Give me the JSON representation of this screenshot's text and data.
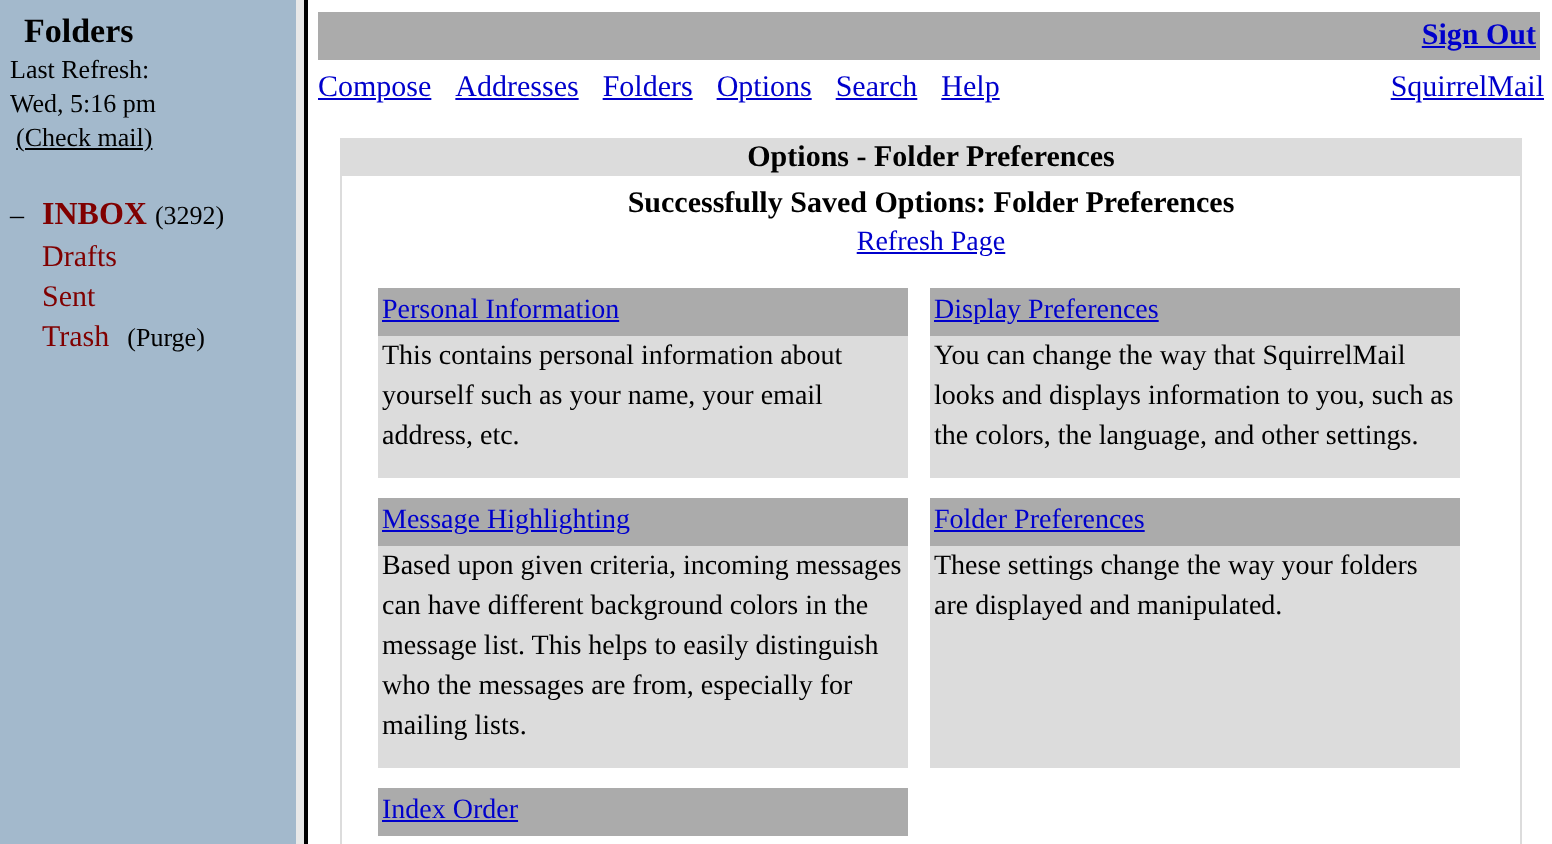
{
  "sidebar": {
    "title": "Folders",
    "refresh_label": "Last Refresh:",
    "refresh_time": "Wed, 5:16 pm",
    "check_mail": "(Check mail)",
    "folders": [
      {
        "toggle": "–",
        "name": "INBOX",
        "count": "(3292)",
        "unread": true
      },
      {
        "name": "Drafts",
        "unread": false
      },
      {
        "name": "Sent",
        "unread": false
      },
      {
        "name": "Trash",
        "action": "(Purge)",
        "unread": false
      }
    ]
  },
  "top_bar": {
    "sign_out": "Sign Out"
  },
  "nav": {
    "links": [
      "Compose",
      "Addresses",
      "Folders",
      "Options",
      "Search",
      "Help"
    ],
    "brand_link": "SquirrelMail"
  },
  "panel": {
    "title": "Options - Folder Preferences",
    "message": "Successfully Saved Options: Folder Preferences",
    "refresh_link": "Refresh Page",
    "sections": [
      {
        "title": "Personal Information",
        "description": "This contains personal information about yourself such as your name, your email address, etc."
      },
      {
        "title": "Display Preferences",
        "description": "You can change the way that SquirrelMail looks and displays information to you, such as the colors, the language, and other settings."
      },
      {
        "title": "Message Highlighting",
        "description": "Based upon given criteria, incoming messages can have different background colors in the message list. This helps to easily distinguish who the messages are from, especially for mailing lists."
      },
      {
        "title": "Folder Preferences",
        "description": "These settings change the way your folders are displayed and manipulated."
      },
      {
        "title": "Index Order"
      }
    ]
  }
}
